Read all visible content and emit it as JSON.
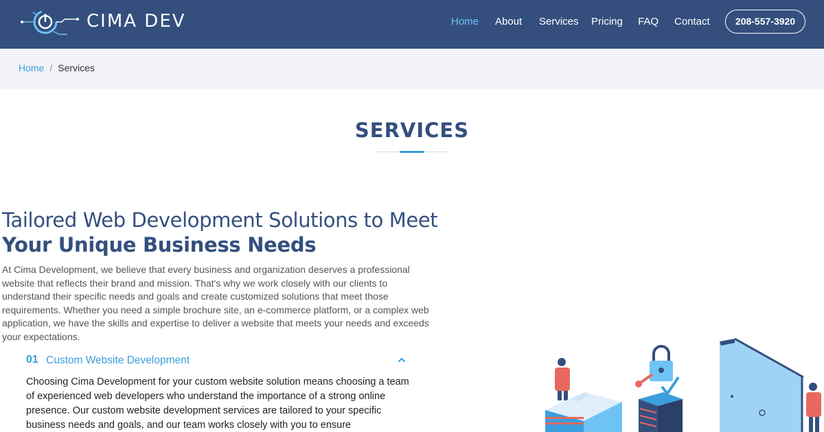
{
  "header": {
    "brand": "CIMA DEV",
    "nav": [
      {
        "label": "Home",
        "active": true
      },
      {
        "label": "About",
        "active": false
      },
      {
        "label": "Services",
        "active": false
      },
      {
        "label": "Pricing",
        "active": false
      },
      {
        "label": "FAQ",
        "active": false
      },
      {
        "label": "Contact",
        "active": false
      }
    ],
    "phone": "208-557-3920"
  },
  "breadcrumb": {
    "home": "Home",
    "separator": "/",
    "current": "Services"
  },
  "section": {
    "title": "SERVICES"
  },
  "intro": {
    "heading_light": "Tailored Web Development Solutions to Meet",
    "heading_bold": "Your Unique Business Needs",
    "paragraph": "At Cima Development, we believe that every business and organization deserves a professional website that reflects their brand and mission. That's why we work closely with our clients to understand their specific needs and goals and create customized solutions that meet those requirements. Whether you need a simple brochure site, an e-commerce platform, or a complex web application, we have the skills and expertise to deliver a website that meets your needs and exceeds your expectations."
  },
  "accordion": {
    "items": [
      {
        "number": "01",
        "title": "Custom Website Development",
        "expanded": true,
        "body": "Choosing Cima Development for your custom website solution means choosing a team of experienced web developers who understand the importance of a strong online presence. Our custom website development services are tailored to your specific business needs and goals, and our team works closely with you to ensure"
      }
    ]
  },
  "colors": {
    "header_bg": "#344f7e",
    "accent": "#3b9fdc",
    "breadcrumb_bg": "#f1f3f8"
  }
}
